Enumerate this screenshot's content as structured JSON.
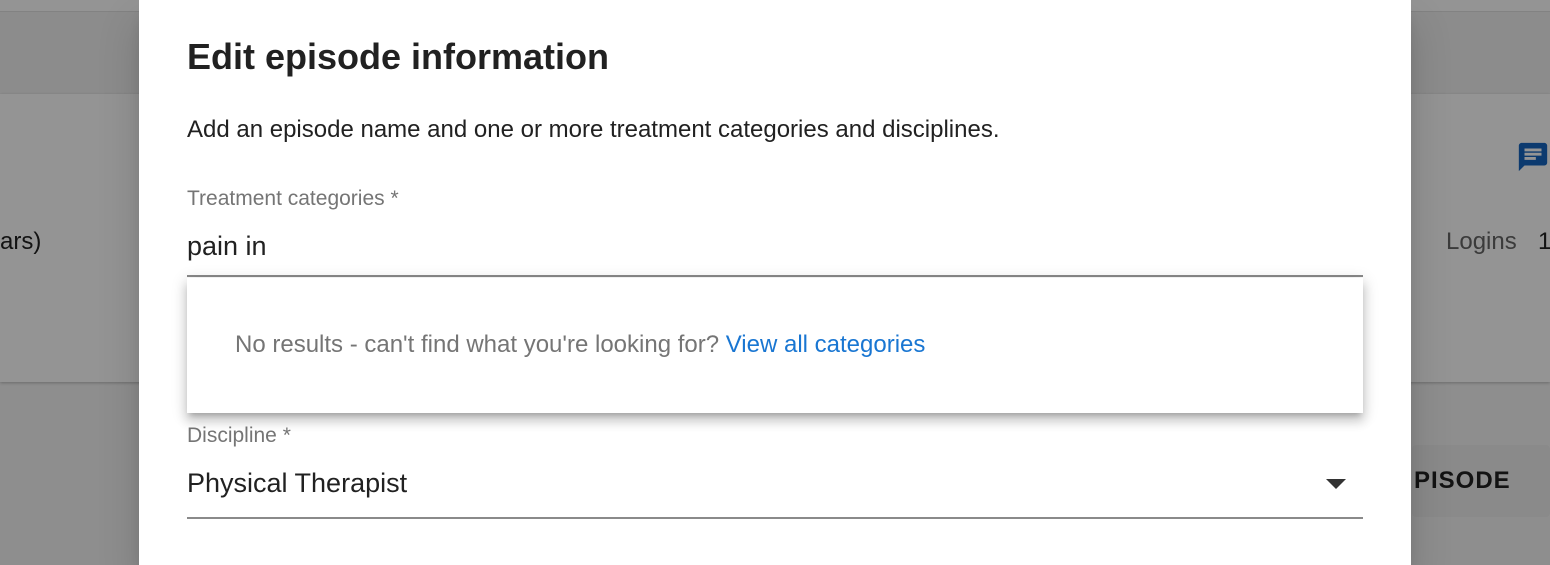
{
  "background": {
    "left_text": "ars)",
    "logins_label": "Logins",
    "logins_value": "1",
    "episode_button_label": "PISODE",
    "chat_icon": "chat-icon"
  },
  "dialog": {
    "title": "Edit episode information",
    "description": "Add an episode name and one or more treatment categories and disciplines.",
    "treatment_categories": {
      "label": "Treatment categories *",
      "value": "pain in",
      "dropdown": {
        "no_results_text": "No results - can't find what you're looking for?",
        "view_all_link": "View all categories"
      }
    },
    "discipline": {
      "label": "Discipline *",
      "value": "Physical Therapist",
      "arrow_icon": "arrow-drop-down-icon"
    }
  },
  "colors": {
    "link": "#1976d2",
    "chat_icon": "#1565c0",
    "label": "#757575",
    "text": "#212121"
  }
}
